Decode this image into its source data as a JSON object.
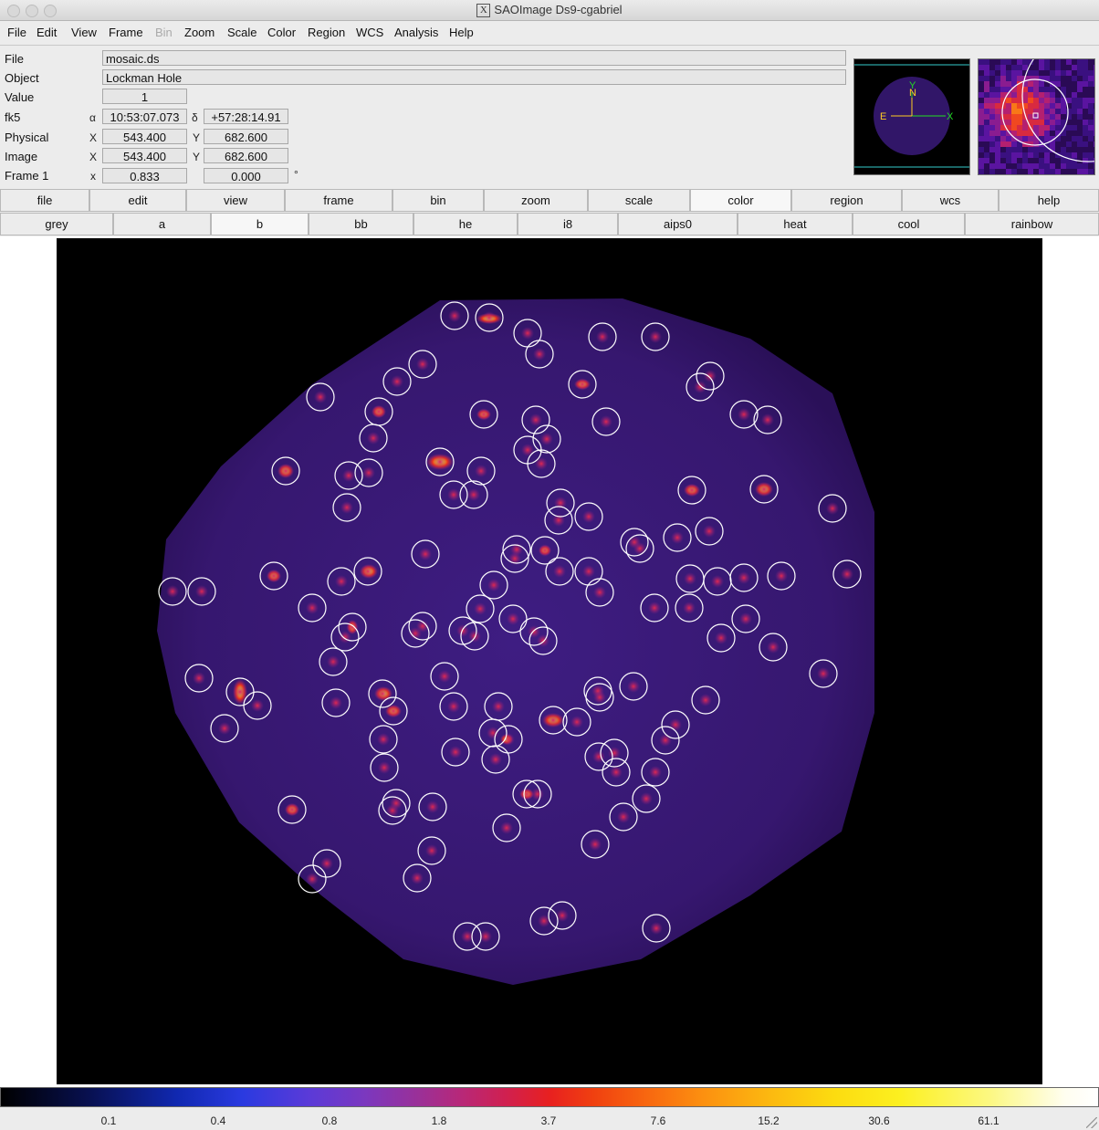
{
  "window": {
    "title": "SAOImage Ds9-cgabriel"
  },
  "menubar": [
    "File",
    "Edit",
    "View",
    "Frame",
    "Bin",
    "Zoom",
    "Scale",
    "Color",
    "Region",
    "WCS",
    "Analysis",
    "Help"
  ],
  "menubar_disabled": [
    "Bin"
  ],
  "info": {
    "file_label": "File",
    "file_value": "mosaic.ds",
    "object_label": "Object",
    "object_value": "Lockman Hole",
    "value_label": "Value",
    "value_value": "1",
    "wcs_label": "fk5",
    "alpha_symbol": "α",
    "alpha_value": "10:53:07.073",
    "delta_symbol": "δ",
    "delta_value": "+57:28:14.91",
    "physical_label": "Physical",
    "physical_x_label": "X",
    "physical_x": "543.400",
    "physical_y_label": "Y",
    "physical_y": "682.600",
    "image_label": "Image",
    "image_x_label": "X",
    "image_x": "543.400",
    "image_y_label": "Y",
    "image_y": "682.600",
    "frame_label": "Frame 1",
    "frame_x_label": "x",
    "frame_zoom": "0.833",
    "frame_angle": "0.000",
    "degree_symbol": "°"
  },
  "panner": {
    "n_label": "N",
    "e_label": "E",
    "x_label": "X",
    "y_label": "Y"
  },
  "buttonbar": {
    "main": [
      "file",
      "edit",
      "view",
      "frame",
      "bin",
      "zoom",
      "scale",
      "color",
      "region",
      "wcs",
      "help"
    ],
    "main_active": "color",
    "color": [
      "grey",
      "a",
      "b",
      "bb",
      "he",
      "i8",
      "aips0",
      "heat",
      "cool",
      "rainbow"
    ],
    "color_active": "b"
  },
  "colorbar": {
    "ticks": [
      "0.1",
      "0.4",
      "0.8",
      "1.8",
      "3.7",
      "7.6",
      "15.2",
      "30.6",
      "61.1"
    ]
  },
  "colors": {
    "image_bg": "#000000",
    "region_circle": "#ffffff",
    "sky": "#3a1a7a"
  }
}
